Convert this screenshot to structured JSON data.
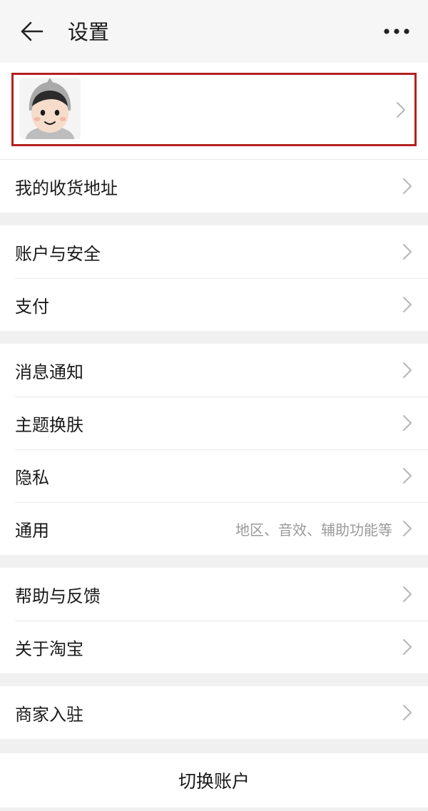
{
  "header": {
    "title": "设置",
    "back_icon": "arrow-left-icon",
    "more_icon": "more-dots-icon"
  },
  "profile": {
    "avatar_icon": "avatar-cartoon-icon",
    "highlight_color": "#b42020"
  },
  "sections": [
    {
      "items": [
        {
          "label": "我的收货地址"
        }
      ]
    },
    {
      "items": [
        {
          "label": "账户与安全"
        },
        {
          "label": "支付"
        }
      ]
    },
    {
      "items": [
        {
          "label": "消息通知"
        },
        {
          "label": "主题换肤"
        },
        {
          "label": "隐私"
        },
        {
          "label": "通用",
          "hint": "地区、音效、辅助功能等"
        }
      ]
    },
    {
      "items": [
        {
          "label": "帮助与反馈"
        },
        {
          "label": "关于淘宝"
        }
      ]
    },
    {
      "items": [
        {
          "label": "商家入驻"
        }
      ]
    }
  ],
  "footer": {
    "switch_account_label": "切换账户"
  }
}
